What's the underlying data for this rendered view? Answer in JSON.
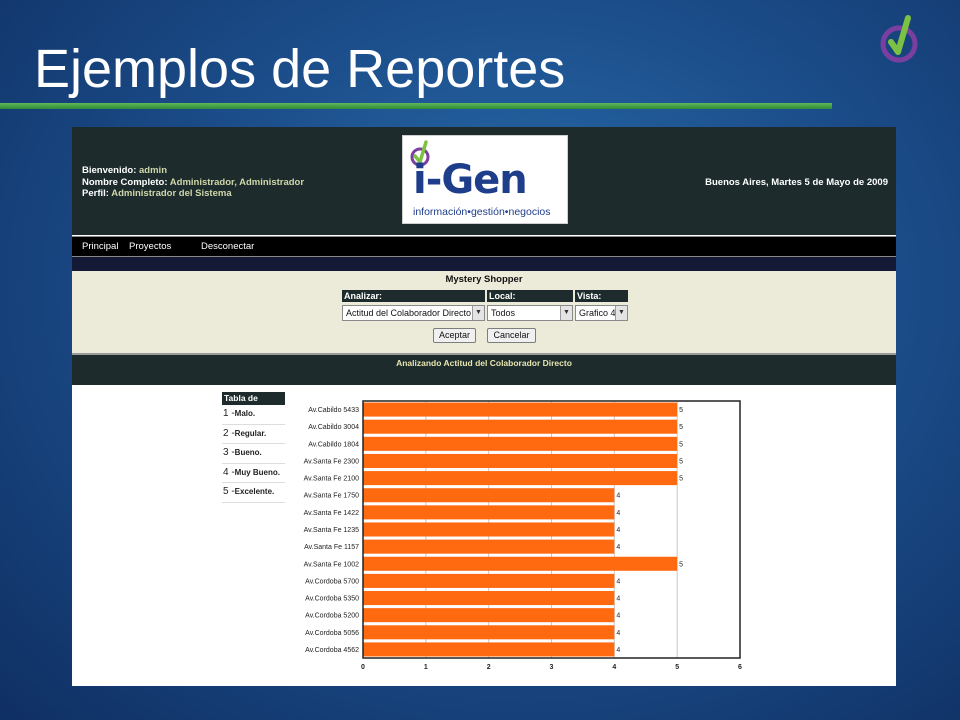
{
  "slide": {
    "title": "Ejemplos de Reportes"
  },
  "header": {
    "welcome_label": "Bienvenido:",
    "welcome_value": "admin",
    "fullname_label": "Nombre Completo:",
    "fullname_value": "Administrador, Administrador",
    "profile_label": "Perfil:",
    "profile_value": "Administrador del Sistema",
    "date": "Buenos Aires, Martes 5 de Mayo de 2009",
    "brand_name": "i-Gen",
    "brand_tagline": "información•gestión•negocios"
  },
  "nav": {
    "items": [
      "Principal",
      "Proyectos",
      "Desconectar"
    ]
  },
  "form": {
    "title": "Mystery Shopper",
    "analizar_label": "Analizar:",
    "analizar_value": "Actitud del Colaborador Directo",
    "local_label": "Local:",
    "local_value": "Todos",
    "vista_label": "Vista:",
    "vista_value": "Grafico 4",
    "accept_label": "Aceptar",
    "cancel_label": "Cancelar"
  },
  "analysis": {
    "title": "Analizando Actitud del Colaborador Directo"
  },
  "legend": {
    "title": "Tabla de Valores",
    "items": [
      {
        "num": "1",
        "label": "Malo."
      },
      {
        "num": "2",
        "label": "Regular."
      },
      {
        "num": "3",
        "label": "Bueno."
      },
      {
        "num": "4",
        "label": "Muy Bueno."
      },
      {
        "num": "5",
        "label": "Excelente."
      }
    ]
  },
  "colors": {
    "bar": "#ff6a10",
    "header": "#1d2b2d",
    "panel": "#ecebda",
    "title_rule": "#3f9a3c"
  },
  "chart_data": {
    "type": "bar",
    "orientation": "horizontal",
    "categories": [
      "Av.Cabildo 5433",
      "Av.Cabildo 3004",
      "Av.Cabildo 1804",
      "Av.Santa Fe 2300",
      "Av.Santa Fe 2100",
      "Av.Santa Fe 1750",
      "Av.Santa Fe 1422",
      "Av.Santa Fe 1235",
      "Av.Santa Fe 1157",
      "Av.Santa Fe 1002",
      "Av.Cordoba 5700",
      "Av.Cordoba 5350",
      "Av.Cordoba 5200",
      "Av.Cordoba 5056",
      "Av.Cordoba 4562"
    ],
    "values": [
      5,
      5,
      5,
      5,
      5,
      4,
      4,
      4,
      4,
      5,
      4,
      4,
      4,
      4,
      4
    ],
    "data_labels": [
      "5",
      "5",
      "5",
      "5",
      "5",
      "4",
      "4",
      "4",
      "4",
      "5",
      "4",
      "4",
      "4",
      "4",
      "4"
    ],
    "x_ticks": [
      "0",
      "1",
      "2",
      "3",
      "4",
      "5",
      "6"
    ],
    "xlim": [
      0,
      6
    ],
    "grid": true
  }
}
